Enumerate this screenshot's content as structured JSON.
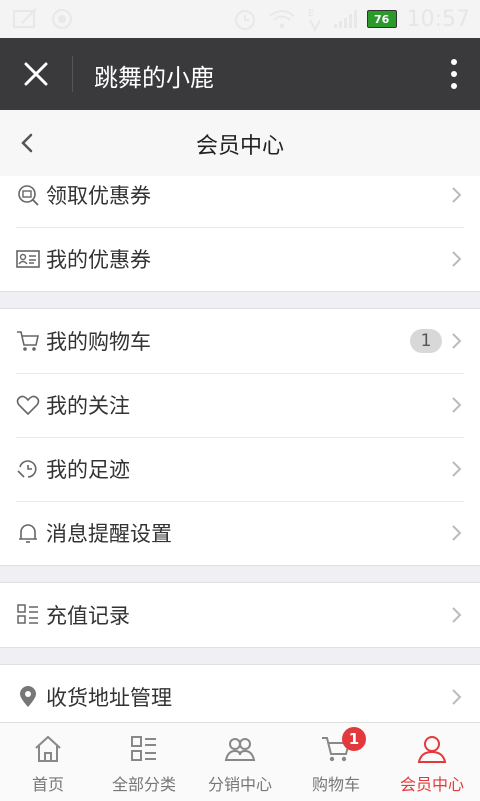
{
  "status_bar": {
    "time": "10:57",
    "battery": "76"
  },
  "header": {
    "title": "跳舞的小鹿"
  },
  "subheader": {
    "title": "会员中心"
  },
  "groups": [
    {
      "items": [
        {
          "label": "领取优惠券",
          "icon": "coupon-search-icon"
        },
        {
          "label": "我的优惠券",
          "icon": "coupon-card-icon"
        }
      ]
    },
    {
      "items": [
        {
          "label": "我的购物车",
          "icon": "cart-icon",
          "badge": "1"
        },
        {
          "label": "我的关注",
          "icon": "heart-icon"
        },
        {
          "label": "我的足迹",
          "icon": "footprint-icon"
        },
        {
          "label": "消息提醒设置",
          "icon": "bell-icon"
        }
      ]
    },
    {
      "items": [
        {
          "label": "充值记录",
          "icon": "list-icon"
        }
      ]
    },
    {
      "items": [
        {
          "label": "收货地址管理",
          "icon": "location-pin-icon"
        }
      ]
    }
  ],
  "tabs": [
    {
      "label": "首页",
      "icon": "home-icon"
    },
    {
      "label": "全部分类",
      "icon": "category-icon"
    },
    {
      "label": "分销中心",
      "icon": "users-icon"
    },
    {
      "label": "购物车",
      "icon": "cart-icon",
      "badge": "1"
    },
    {
      "label": "会员中心",
      "icon": "user-icon",
      "active": true
    }
  ],
  "colors": {
    "accent": "#e4393c",
    "header_bg": "#3a3a3c"
  }
}
